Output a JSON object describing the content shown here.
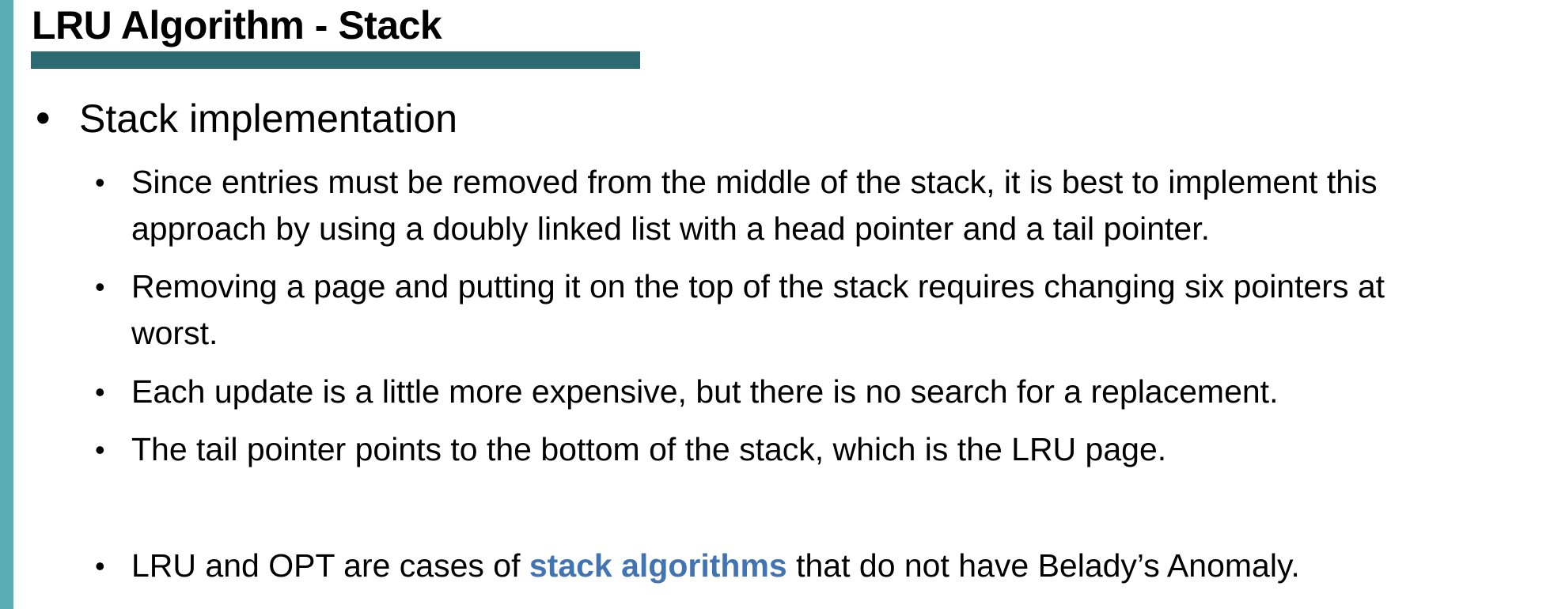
{
  "slide": {
    "title": "LRU Algorithm - Stack",
    "bullet_symbol": "•",
    "level1_text": "Stack implementation",
    "sub_bullets": [
      {
        "line1": "Since entries must be removed from the middle of the stack, it is best to implement this",
        "line2": "approach by using a doubly linked list with a head pointer and a tail pointer."
      },
      {
        "line1": "Removing a page and putting it on the top of the stack requires changing six pointers at",
        "line2": "worst."
      },
      {
        "line1": "Each update is a little more expensive, but there is no search for a replacement."
      },
      {
        "line1": "The tail pointer points to the bottom of the stack, which is the LRU page."
      }
    ],
    "final_bullet": {
      "before": "LRU and OPT are cases of ",
      "highlight": "stack algorithms",
      "after": " that do not have Belady’s Anomaly."
    }
  },
  "colors": {
    "left_bar": "#5aadb4",
    "title_underline": "#2d6b72",
    "highlight": "#4274b4"
  }
}
